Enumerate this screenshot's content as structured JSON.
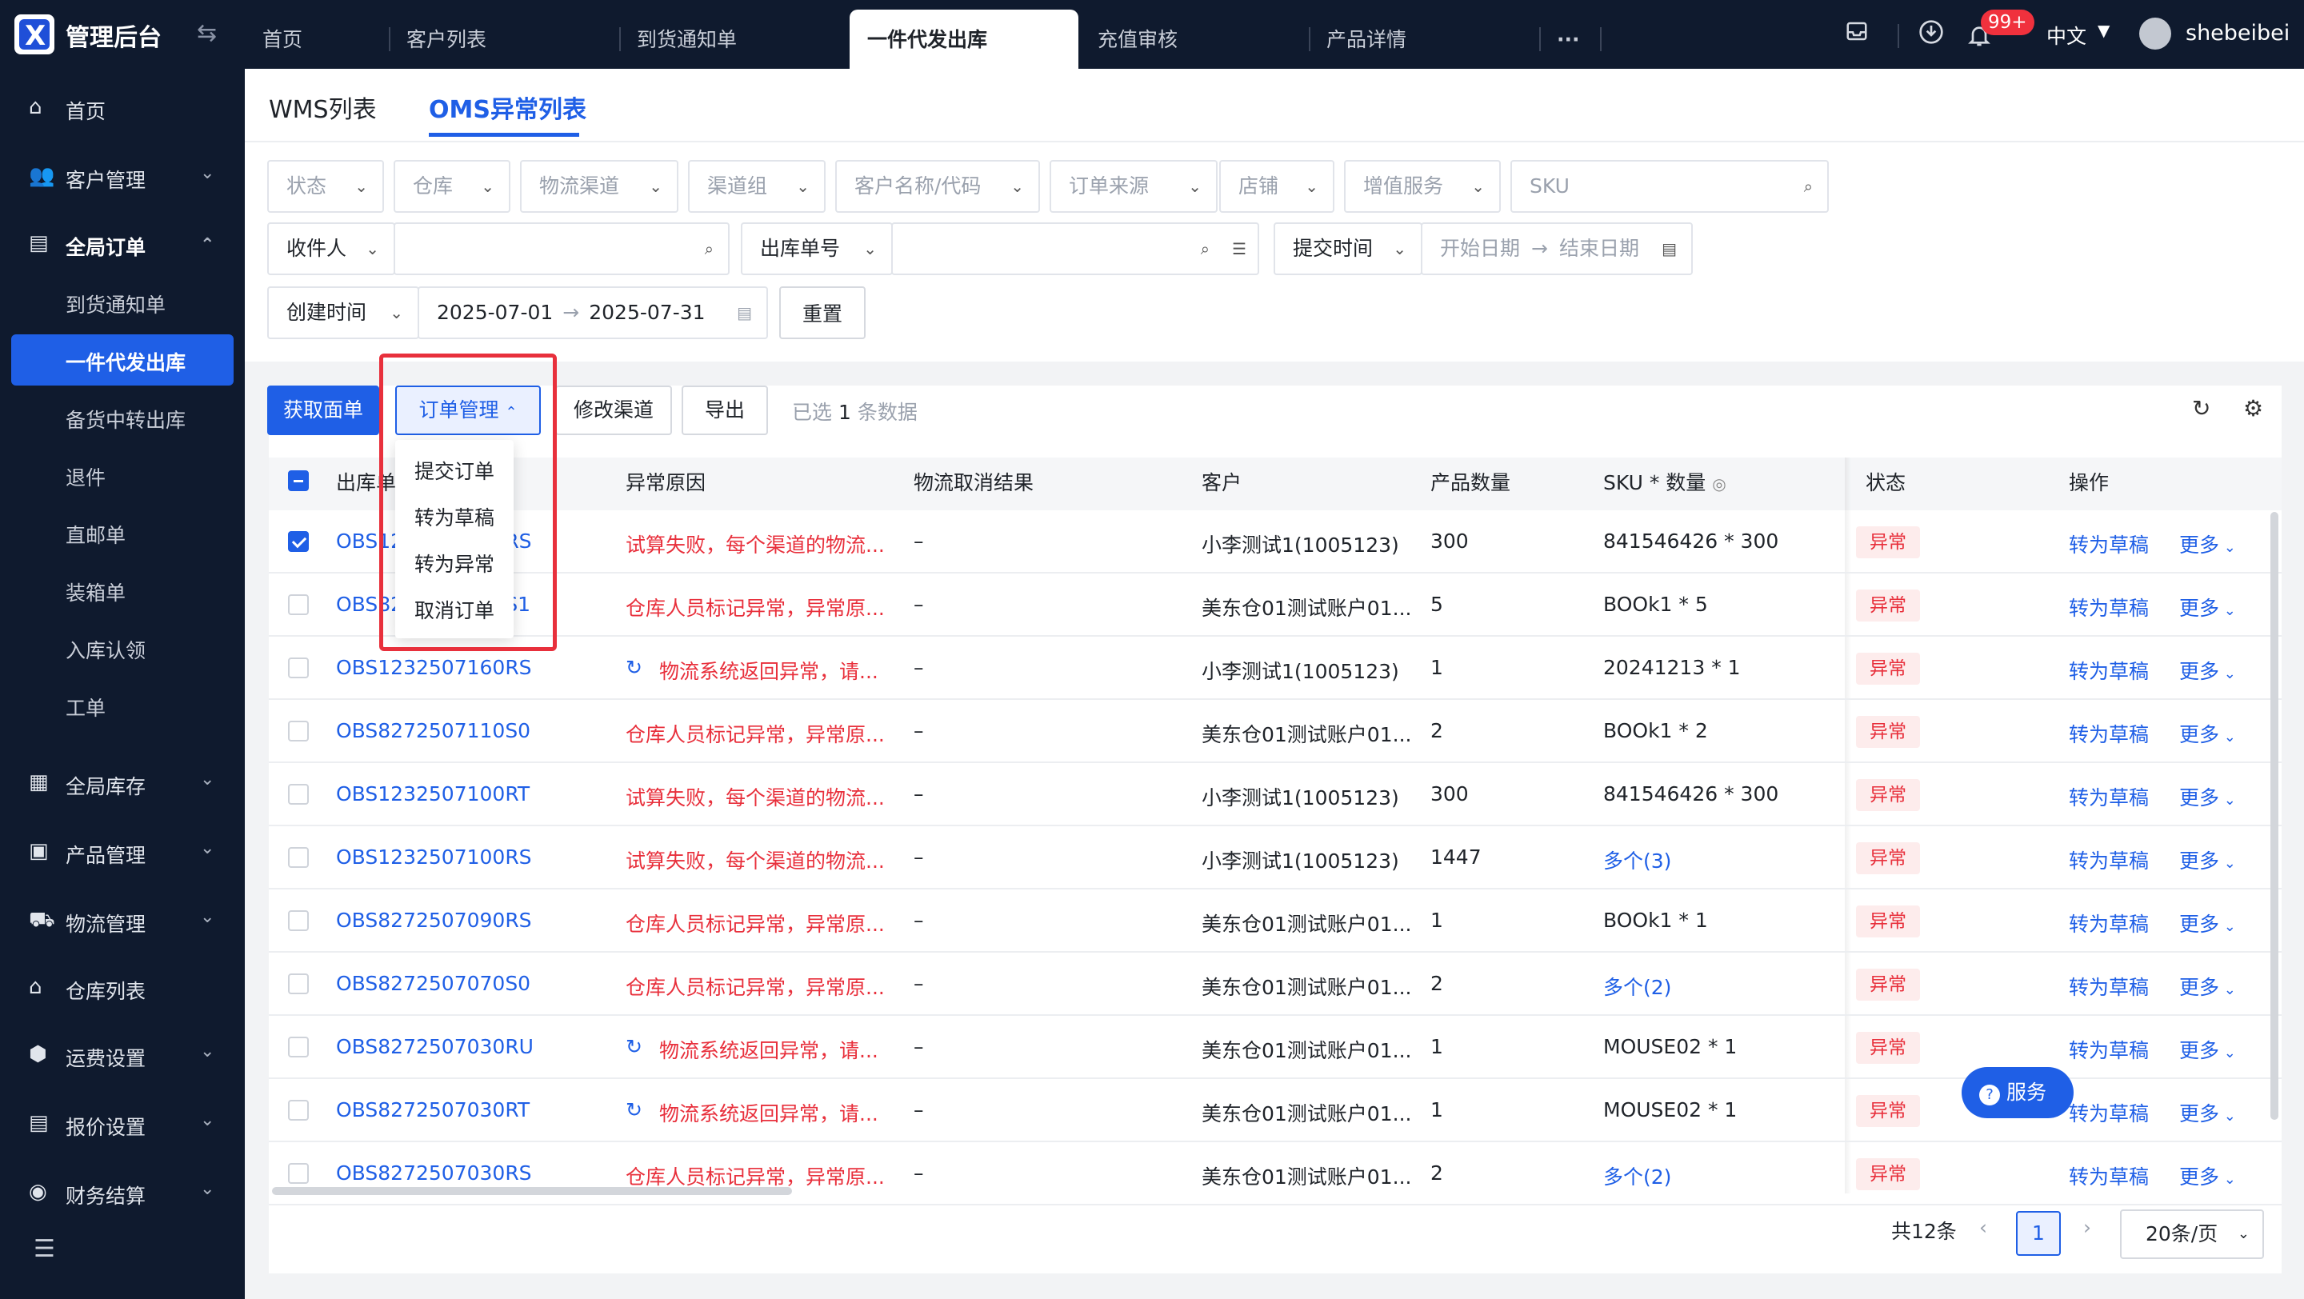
{
  "app": {
    "brand": "管理后台",
    "user": "shebeibei",
    "lang": "中文",
    "notify_badge": "99+"
  },
  "tabs": [
    {
      "label": "首页"
    },
    {
      "label": "客户列表"
    },
    {
      "label": "到货通知单"
    },
    {
      "label": "一件代发出库"
    },
    {
      "label": "充值审核"
    },
    {
      "label": "产品详情"
    },
    {
      "label": "···"
    }
  ],
  "sidebar": {
    "items": [
      {
        "label": "首页"
      },
      {
        "label": "客户管理"
      },
      {
        "label": "全局订单"
      },
      {
        "label": "全局库存"
      },
      {
        "label": "产品管理"
      },
      {
        "label": "物流管理"
      },
      {
        "label": "仓库列表"
      },
      {
        "label": "运费设置"
      },
      {
        "label": "报价设置"
      },
      {
        "label": "财务结算"
      }
    ],
    "sub": [
      {
        "label": "到货通知单"
      },
      {
        "label": "一件代发出库"
      },
      {
        "label": "备货中转出库"
      },
      {
        "label": "退件"
      },
      {
        "label": "直邮单"
      },
      {
        "label": "装箱单"
      },
      {
        "label": "入库认领"
      },
      {
        "label": "工单"
      }
    ]
  },
  "subtabs": [
    {
      "label": "WMS列表"
    },
    {
      "label": "OMS异常列表"
    }
  ],
  "filters": {
    "row1": [
      "状态",
      "仓库",
      "物流渠道",
      "渠道组",
      "客户名称/代码",
      "订单来源",
      "店铺",
      "增值服务"
    ],
    "sku_placeholder": "SKU",
    "recipient": "收件人",
    "outbound_no": "出库单号",
    "submit_time": "提交时间",
    "start_date": "开始日期",
    "end_date": "结束日期",
    "create_time": "创建时间",
    "create_start": "2025-07-01",
    "create_end": "2025-07-31",
    "reset": "重置"
  },
  "toolbar": {
    "get_label": "获取面单",
    "order_mgmt": "订单管理",
    "change_channel": "修改渠道",
    "export": "导出",
    "selected_prefix": "已选",
    "selected_count": "1",
    "selected_suffix": "条数据"
  },
  "menu": [
    "提交订单",
    "转为草稿",
    "转为异常",
    "取消订单"
  ],
  "columns": [
    "出库单号",
    "异常原因",
    "物流取消结果",
    "客户",
    "产品数量",
    "SKU * 数量",
    "状态",
    "操作"
  ],
  "rows": [
    {
      "no": "OBS1232507170RS",
      "reason": "试算失败，每个渠道的物流...",
      "icon": false,
      "cancel": "–",
      "customer": "小李测试1(1005123)",
      "qty": "300",
      "sku": "841546426 * 300",
      "sku_link": false,
      "status": "异常",
      "checked": true
    },
    {
      "no": "OBS8272507160S1",
      "reason": "仓库人员标记异常，异常原...",
      "icon": false,
      "cancel": "–",
      "customer": "美东仓01测试账户01...",
      "qty": "5",
      "sku": "BOOk1 * 5",
      "sku_link": false,
      "status": "异常",
      "checked": false
    },
    {
      "no": "OBS1232507160RS",
      "reason": "物流系统返回异常，请...",
      "icon": true,
      "cancel": "–",
      "customer": "小李测试1(1005123)",
      "qty": "1",
      "sku": "20241213 * 1",
      "sku_link": false,
      "status": "异常",
      "checked": false
    },
    {
      "no": "OBS8272507110S0",
      "reason": "仓库人员标记异常，异常原...",
      "icon": false,
      "cancel": "–",
      "customer": "美东仓01测试账户01...",
      "qty": "2",
      "sku": "BOOk1 * 2",
      "sku_link": false,
      "status": "异常",
      "checked": false
    },
    {
      "no": "OBS1232507100RT",
      "reason": "试算失败，每个渠道的物流...",
      "icon": false,
      "cancel": "–",
      "customer": "小李测试1(1005123)",
      "qty": "300",
      "sku": "841546426 * 300",
      "sku_link": false,
      "status": "异常",
      "checked": false
    },
    {
      "no": "OBS1232507100RS",
      "reason": "试算失败，每个渠道的物流...",
      "icon": false,
      "cancel": "–",
      "customer": "小李测试1(1005123)",
      "qty": "1447",
      "sku": "多个(3)",
      "sku_link": true,
      "status": "异常",
      "checked": false
    },
    {
      "no": "OBS8272507090RS",
      "reason": "仓库人员标记异常，异常原...",
      "icon": false,
      "cancel": "–",
      "customer": "美东仓01测试账户01...",
      "qty": "1",
      "sku": "BOOk1 * 1",
      "sku_link": false,
      "status": "异常",
      "checked": false
    },
    {
      "no": "OBS8272507070S0",
      "reason": "仓库人员标记异常，异常原...",
      "icon": false,
      "cancel": "–",
      "customer": "美东仓01测试账户01...",
      "qty": "2",
      "sku": "多个(2)",
      "sku_link": true,
      "status": "异常",
      "checked": false
    },
    {
      "no": "OBS8272507030RU",
      "reason": "物流系统返回异常，请...",
      "icon": true,
      "cancel": "–",
      "customer": "美东仓01测试账户01...",
      "qty": "1",
      "sku": "MOUSE02 * 1",
      "sku_link": false,
      "status": "异常",
      "checked": false
    },
    {
      "no": "OBS8272507030RT",
      "reason": "物流系统返回异常，请...",
      "icon": true,
      "cancel": "–",
      "customer": "美东仓01测试账户01...",
      "qty": "1",
      "sku": "MOUSE02 * 1",
      "sku_link": false,
      "status": "异常",
      "checked": false
    },
    {
      "no": "OBS8272507030RS",
      "reason": "仓库人员标记异常，异常原...",
      "icon": false,
      "cancel": "–",
      "customer": "美东仓01测试账户01...",
      "qty": "2",
      "sku": "多个(2)",
      "sku_link": true,
      "status": "异常",
      "checked": false
    }
  ],
  "actions": {
    "draft": "转为草稿",
    "more": "更多"
  },
  "service": "服务",
  "pager": {
    "total": "共12条",
    "page": "1",
    "size": "20条/页"
  }
}
